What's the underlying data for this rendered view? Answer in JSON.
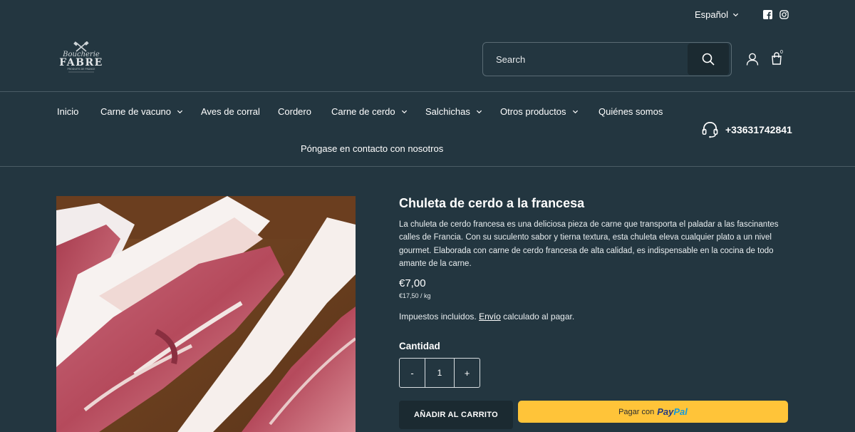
{
  "header": {
    "language": "Español",
    "logo_text_script": "Boucherie",
    "logo_text_main": "FABRE",
    "logo_text_small": "PRODUITS DE FRANCE",
    "search_placeholder": "Search",
    "cart_count": "0",
    "icons": {
      "language_chevron": "chevron-down-icon",
      "facebook": "facebook-icon",
      "instagram": "instagram-icon",
      "search": "search-icon",
      "account": "user-icon",
      "cart": "shopping-bag-icon",
      "phone": "headset-icon"
    }
  },
  "nav": {
    "items": [
      {
        "label": "Inicio",
        "dropdown": false
      },
      {
        "label": "Carne de vacuno",
        "dropdown": true
      },
      {
        "label": "Aves de corral",
        "dropdown": false
      },
      {
        "label": "Cordero",
        "dropdown": false
      },
      {
        "label": "Carne de cerdo",
        "dropdown": true
      },
      {
        "label": "Salchichas",
        "dropdown": true
      },
      {
        "label": "Otros productos",
        "dropdown": true
      },
      {
        "label": "Quiénes somos",
        "dropdown": false
      },
      {
        "label": "Póngase en contacto con nosotros",
        "dropdown": false
      }
    ],
    "phone": "+33631742841"
  },
  "product": {
    "title": "Chuleta de cerdo a la francesa",
    "description": "La chuleta de cerdo francesa es una deliciosa pieza de carne que transporta el paladar a las fascinantes calles de Francia. Con su suculento sabor y tierna textura, esta chuleta eleva cualquier plato a un nivel gourmet. Elaborada con carne de cerdo francesa de alta calidad, es indispensable en la cocina de todo amante de la carne.",
    "price": "€7,00",
    "unit_price": "€17,50 / kg",
    "tax_prefix": "Impuestos incluidos.",
    "shipping_link": "Envío",
    "tax_suffix": "calculado al pagar.",
    "quantity_label": "Cantidad",
    "quantity_minus": "-",
    "quantity_value": "1",
    "quantity_plus": "+",
    "add_to_cart": "AÑADIR AL CARRITO",
    "paypal_prefix": "Pagar con",
    "paypal_brand_1": "Pay",
    "paypal_brand_2": "Pal"
  },
  "colors": {
    "background": "#233640",
    "button_dark": "#1b2a31",
    "paypal_yellow": "#ffc439",
    "divider": "#4a5c65"
  }
}
